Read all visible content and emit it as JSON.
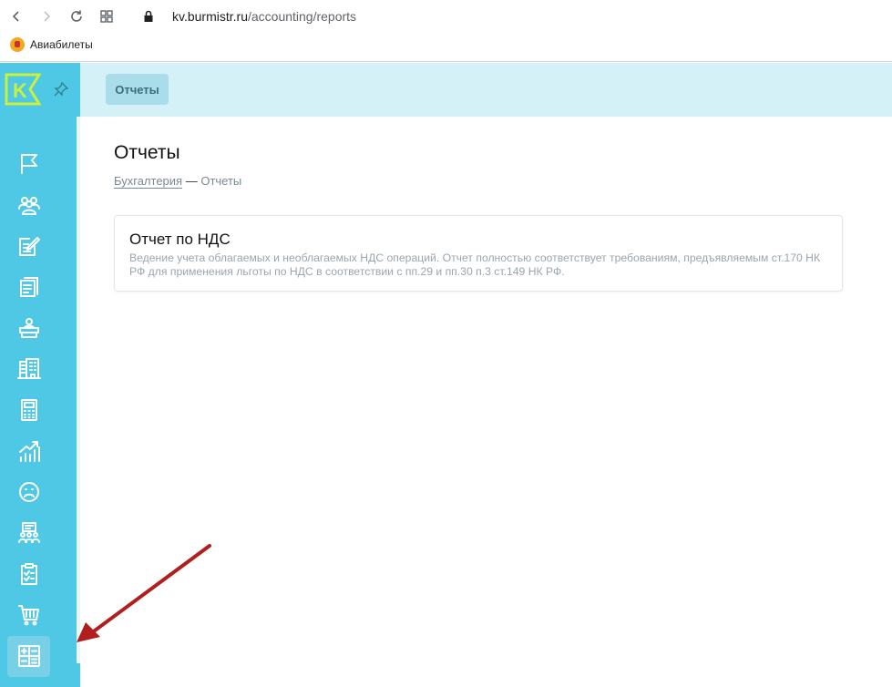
{
  "browser": {
    "url_host": "kv.burmistr.ru",
    "url_path": "/accounting/reports",
    "bookmark_label": "Авиабилеты"
  },
  "sidebar": {
    "logo_letter": "K",
    "items": [
      {
        "icon": "flag-icon"
      },
      {
        "icon": "people-icon"
      },
      {
        "icon": "edit-document-icon"
      },
      {
        "icon": "documents-icon"
      },
      {
        "icon": "reception-desk-icon"
      },
      {
        "icon": "building-icon"
      },
      {
        "icon": "calculator-icon"
      },
      {
        "icon": "growth-chart-icon"
      },
      {
        "icon": "sad-face-icon"
      },
      {
        "icon": "meeting-icon"
      },
      {
        "icon": "checklist-icon"
      },
      {
        "icon": "cart-icon"
      },
      {
        "icon": "accounting-icon",
        "active": true
      }
    ]
  },
  "topbar": {
    "tab_label": "Отчеты"
  },
  "page": {
    "title": "Отчеты",
    "breadcrumb_parent": "Бухгалтерия",
    "breadcrumb_sep": " — ",
    "breadcrumb_current": "Отчеты"
  },
  "reports": [
    {
      "title": "Отчет по НДС",
      "description": "Ведение учета облагаемых и необлагаемых НДС операций. Отчет полностью соответствует требованиям, предъявляемым ст.170 НК РФ для применения льготы по НДС в соответствии с пп.29 и пп.30 п.3 ст.149 НК РФ."
    }
  ],
  "colors": {
    "sidebar": "#4ec8e4",
    "topbar": "#d3f1f7",
    "logo": "#c8f03c",
    "arrow": "#b01e1e"
  }
}
